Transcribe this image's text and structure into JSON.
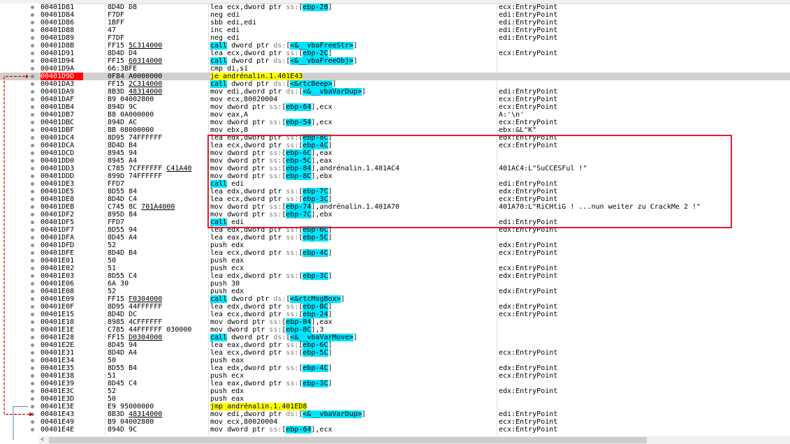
{
  "rows": [
    {
      "addr": "00401D81",
      "bytes": "8D4D D8",
      "instr": [
        {
          "t": "lea ecx,dword ptr "
        },
        {
          "t": "ss:",
          "c": "seg"
        },
        {
          "t": "["
        },
        {
          "t": "ebp-28",
          "c": "ref"
        },
        {
          "t": "]"
        }
      ],
      "cmt": "ecx:EntryPoint"
    },
    {
      "addr": "00401D84",
      "bytes": "F7DF",
      "instr": [
        {
          "t": "neg edi"
        }
      ],
      "cmt": "edi:EntryPoint"
    },
    {
      "addr": "00401D86",
      "bytes": "1BFF",
      "instr": [
        {
          "t": "sbb edi,edi"
        }
      ],
      "cmt": "edi:EntryPoint"
    },
    {
      "addr": "00401D88",
      "bytes": "47",
      "instr": [
        {
          "t": "inc edi"
        }
      ],
      "cmt": "edi:EntryPoint"
    },
    {
      "addr": "00401D89",
      "bytes": "F7DF",
      "instr": [
        {
          "t": "neg edi"
        }
      ],
      "cmt": "edi:EntryPoint"
    },
    {
      "addr": "00401D8B",
      "bytes": "FF15 ",
      "bytesU": "5C314000",
      "instr": [
        {
          "t": "call",
          "c": "call"
        },
        {
          "t": " dword ptr "
        },
        {
          "t": "ds:",
          "c": "seg"
        },
        {
          "t": "["
        },
        {
          "t": "<&__vbaFreeStr>",
          "c": "ref"
        },
        {
          "t": "]"
        }
      ],
      "cmt": ""
    },
    {
      "addr": "00401D91",
      "bytes": "8D4D D4",
      "instr": [
        {
          "t": "lea ecx,dword ptr "
        },
        {
          "t": "ss:",
          "c": "seg"
        },
        {
          "t": "["
        },
        {
          "t": "ebp-2C",
          "c": "ref"
        },
        {
          "t": "]"
        }
      ],
      "cmt": "ecx:EntryPoint"
    },
    {
      "addr": "00401D94",
      "bytes": "FF15 ",
      "bytesU": "60314000",
      "instr": [
        {
          "t": "call",
          "c": "call"
        },
        {
          "t": " dword ptr "
        },
        {
          "t": "ds:",
          "c": "seg"
        },
        {
          "t": "["
        },
        {
          "t": "<&__vbaFreeObj>",
          "c": "ref"
        },
        {
          "t": "]"
        }
      ],
      "cmt": ""
    },
    {
      "addr": "00401D9A",
      "bytes": "66:3BFE",
      "instr": [
        {
          "t": "cmp di,si"
        }
      ],
      "cmt": ""
    },
    {
      "addr": "00401D9D",
      "bytes": "0F84 A0000000",
      "sel": true,
      "instr": [
        {
          "t": "je andrénalin.1.401E43",
          "c": "hl"
        }
      ],
      "cmt": ""
    },
    {
      "addr": "00401DA3",
      "bytes": "FF15 ",
      "bytesU": "2C314000",
      "instr": [
        {
          "t": "call",
          "c": "call"
        },
        {
          "t": " dword ptr "
        },
        {
          "t": "ds:",
          "c": "seg"
        },
        {
          "t": "["
        },
        {
          "t": "<&rtcBeep>",
          "c": "ref"
        },
        {
          "t": "]"
        }
      ],
      "cmt": ""
    },
    {
      "addr": "00401DA9",
      "bytes": "8B3D ",
      "bytesU": "48314000",
      "instr": [
        {
          "t": "mov edi,dword ptr "
        },
        {
          "t": "ds:",
          "c": "seg"
        },
        {
          "t": "["
        },
        {
          "t": "<&__vbaVarDup>",
          "c": "ref"
        },
        {
          "t": "]"
        }
      ],
      "cmt": "edi:EntryPoint"
    },
    {
      "addr": "00401DAF",
      "bytes": "B9 04002800",
      "instr": [
        {
          "t": "mov ecx,80020004"
        }
      ],
      "cmt": "ecx:EntryPoint"
    },
    {
      "addr": "00401DB4",
      "bytes": "894D 9C",
      "instr": [
        {
          "t": "mov dword ptr "
        },
        {
          "t": "ss:",
          "c": "seg"
        },
        {
          "t": "["
        },
        {
          "t": "ebp-64",
          "c": "ref"
        },
        {
          "t": "],ecx"
        }
      ],
      "cmt": "ecx:EntryPoint"
    },
    {
      "addr": "00401DB7",
      "bytes": "B8 0A000000",
      "instr": [
        {
          "t": "mov eax,A"
        }
      ],
      "cmt": "A:'\\n'"
    },
    {
      "addr": "00401DBC",
      "bytes": "894D AC",
      "instr": [
        {
          "t": "mov dword ptr "
        },
        {
          "t": "ss:",
          "c": "seg"
        },
        {
          "t": "["
        },
        {
          "t": "ebp-54",
          "c": "ref"
        },
        {
          "t": "],ecx"
        }
      ],
      "cmt": "ecx:EntryPoint"
    },
    {
      "addr": "00401DBF",
      "bytes": "BB 08000000",
      "instr": [
        {
          "t": "mov ebx,8"
        }
      ],
      "cmt": "ebx:&L\"K\""
    },
    {
      "addr": "00401DC4",
      "bytes": "8D95 74FFFFFF",
      "instr": [
        {
          "t": "lea edx,dword ptr "
        },
        {
          "t": "ss:",
          "c": "seg"
        },
        {
          "t": "["
        },
        {
          "t": "ebp-8C",
          "c": "ref"
        },
        {
          "t": "]"
        }
      ],
      "cmt": "edx:EntryPoint"
    },
    {
      "addr": "00401DCA",
      "bytes": "8D4D B4",
      "instr": [
        {
          "t": "lea ecx,dword ptr "
        },
        {
          "t": "ss:",
          "c": "seg"
        },
        {
          "t": "["
        },
        {
          "t": "ebp-4C",
          "c": "ref"
        },
        {
          "t": "]"
        }
      ],
      "cmt": "ecx:EntryPoint"
    },
    {
      "addr": "00401DCD",
      "bytes": "8945 94",
      "instr": [
        {
          "t": "mov dword ptr "
        },
        {
          "t": "ss:",
          "c": "seg"
        },
        {
          "t": "["
        },
        {
          "t": "ebp-6C",
          "c": "ref"
        },
        {
          "t": "],eax"
        }
      ],
      "cmt": ""
    },
    {
      "addr": "00401DD0",
      "bytes": "8945 A4",
      "instr": [
        {
          "t": "mov dword ptr "
        },
        {
          "t": "ss:",
          "c": "seg"
        },
        {
          "t": "["
        },
        {
          "t": "ebp-5C",
          "c": "ref"
        },
        {
          "t": "],eax"
        }
      ],
      "cmt": ""
    },
    {
      "addr": "00401DD3",
      "bytes": "C785 7CFFFFFF ",
      "bytesU": "C41A40",
      "instr": [
        {
          "t": "mov dword ptr "
        },
        {
          "t": "ss:",
          "c": "seg"
        },
        {
          "t": "["
        },
        {
          "t": "ebp-84",
          "c": "ref"
        },
        {
          "t": "],andrénalin.1.401AC4"
        }
      ],
      "cmt": "401AC4:L\"SuCCESFul !\""
    },
    {
      "addr": "00401DDD",
      "bytes": "899D 74FFFFFF",
      "instr": [
        {
          "t": "mov dword ptr "
        },
        {
          "t": "ss:",
          "c": "seg"
        },
        {
          "t": "["
        },
        {
          "t": "ebp-8C",
          "c": "ref"
        },
        {
          "t": "],ebx"
        }
      ],
      "cmt": ""
    },
    {
      "addr": "00401DE3",
      "bytes": "FFD7",
      "instr": [
        {
          "t": "call",
          "c": "call"
        },
        {
          "t": " edi"
        }
      ],
      "cmt": "edi:EntryPoint"
    },
    {
      "addr": "00401DE5",
      "bytes": "8D55 84",
      "instr": [
        {
          "t": "lea edx,dword ptr "
        },
        {
          "t": "ss:",
          "c": "seg"
        },
        {
          "t": "["
        },
        {
          "t": "ebp-7C",
          "c": "ref"
        },
        {
          "t": "]"
        }
      ],
      "cmt": "edx:EntryPoint"
    },
    {
      "addr": "00401DE8",
      "bytes": "8D4D C4",
      "instr": [
        {
          "t": "lea ecx,dword ptr "
        },
        {
          "t": "ss:",
          "c": "seg"
        },
        {
          "t": "["
        },
        {
          "t": "ebp-3C",
          "c": "ref"
        },
        {
          "t": "]"
        }
      ],
      "cmt": "ecx:EntryPoint"
    },
    {
      "addr": "00401DEB",
      "bytes": "C745 8C ",
      "bytesU": "701A4000",
      "instr": [
        {
          "t": "mov dword ptr "
        },
        {
          "t": "ss:",
          "c": "seg"
        },
        {
          "t": "["
        },
        {
          "t": "ebp-74",
          "c": "ref"
        },
        {
          "t": "],andrénalin.1.401A70"
        }
      ],
      "cmt": "401A70:L\"RiCHtiG ! ...nun weiter zu CrackMe 2 !\""
    },
    {
      "addr": "00401DF2",
      "bytes": "895D 84",
      "instr": [
        {
          "t": "mov dword ptr "
        },
        {
          "t": "ss:",
          "c": "seg"
        },
        {
          "t": "["
        },
        {
          "t": "ebp-7C",
          "c": "ref"
        },
        {
          "t": "],ebx"
        }
      ],
      "cmt": ""
    },
    {
      "addr": "00401DF5",
      "bytes": "FFD7",
      "instr": [
        {
          "t": "call",
          "c": "call"
        },
        {
          "t": " edi"
        }
      ],
      "cmt": "edi:EntryPoint"
    },
    {
      "addr": "00401DF7",
      "bytes": "8D55 94",
      "instr": [
        {
          "t": "lea edx,dword ptr "
        },
        {
          "t": "ss:",
          "c": "seg"
        },
        {
          "t": "["
        },
        {
          "t": "ebp-6C",
          "c": "ref"
        },
        {
          "t": "]"
        }
      ],
      "cmt": "edx:EntryPoint"
    },
    {
      "addr": "00401DFA",
      "bytes": "8D45 A4",
      "instr": [
        {
          "t": "lea eax,dword ptr "
        },
        {
          "t": "ss:",
          "c": "seg"
        },
        {
          "t": "["
        },
        {
          "t": "ebp-5C",
          "c": "ref"
        },
        {
          "t": "]"
        }
      ],
      "cmt": ""
    },
    {
      "addr": "00401DFD",
      "bytes": "52",
      "instr": [
        {
          "t": "push edx"
        }
      ],
      "cmt": "edx:EntryPoint"
    },
    {
      "addr": "00401DFE",
      "bytes": "8D4D B4",
      "instr": [
        {
          "t": "lea ecx,dword ptr "
        },
        {
          "t": "ss:",
          "c": "seg"
        },
        {
          "t": "["
        },
        {
          "t": "ebp-4C",
          "c": "ref"
        },
        {
          "t": "]"
        }
      ],
      "cmt": "ecx:EntryPoint"
    },
    {
      "addr": "00401E01",
      "bytes": "50",
      "instr": [
        {
          "t": "push eax"
        }
      ],
      "cmt": ""
    },
    {
      "addr": "00401E02",
      "bytes": "51",
      "instr": [
        {
          "t": "push ecx"
        }
      ],
      "cmt": "ecx:EntryPoint"
    },
    {
      "addr": "00401E03",
      "bytes": "8D55 C4",
      "instr": [
        {
          "t": "lea edx,dword ptr "
        },
        {
          "t": "ss:",
          "c": "seg"
        },
        {
          "t": "["
        },
        {
          "t": "ebp-3C",
          "c": "ref"
        },
        {
          "t": "]"
        }
      ],
      "cmt": "edx:EntryPoint"
    },
    {
      "addr": "00401E06",
      "bytes": "6A 30",
      "instr": [
        {
          "t": "push 30"
        }
      ],
      "cmt": ""
    },
    {
      "addr": "00401E08",
      "bytes": "52",
      "instr": [
        {
          "t": "push edx"
        }
      ],
      "cmt": "edx:EntryPoint"
    },
    {
      "addr": "00401E09",
      "bytes": "FF15 ",
      "bytesU": "F0304000",
      "instr": [
        {
          "t": "call",
          "c": "call"
        },
        {
          "t": " dword ptr "
        },
        {
          "t": "ds:",
          "c": "seg"
        },
        {
          "t": "["
        },
        {
          "t": "<&rtcMsgBox>",
          "c": "ref"
        },
        {
          "t": "]"
        }
      ],
      "cmt": ""
    },
    {
      "addr": "00401E0F",
      "bytes": "8D95 44FFFFFF",
      "instr": [
        {
          "t": "lea edx,dword ptr "
        },
        {
          "t": "ss:",
          "c": "seg"
        },
        {
          "t": "["
        },
        {
          "t": "ebp-BC",
          "c": "ref"
        },
        {
          "t": "]"
        }
      ],
      "cmt": "edx:EntryPoint"
    },
    {
      "addr": "00401E15",
      "bytes": "8D4D DC",
      "instr": [
        {
          "t": "lea ecx,dword ptr "
        },
        {
          "t": "ss:",
          "c": "seg"
        },
        {
          "t": "["
        },
        {
          "t": "ebp-24",
          "c": "ref"
        },
        {
          "t": "]"
        }
      ],
      "cmt": "ecx:EntryPoint"
    },
    {
      "addr": "00401E18",
      "bytes": "8985 4CFFFFFF",
      "instr": [
        {
          "t": "mov dword ptr "
        },
        {
          "t": "ss:",
          "c": "seg"
        },
        {
          "t": "["
        },
        {
          "t": "ebp-B4",
          "c": "ref"
        },
        {
          "t": "],eax"
        }
      ],
      "cmt": ""
    },
    {
      "addr": "00401E1E",
      "bytes": "C785 44FFFFFF 030000",
      "instr": [
        {
          "t": "mov dword ptr "
        },
        {
          "t": "ss:",
          "c": "seg"
        },
        {
          "t": "["
        },
        {
          "t": "ebp-BC",
          "c": "ref"
        },
        {
          "t": "],3"
        }
      ],
      "cmt": ""
    },
    {
      "addr": "00401E28",
      "bytes": "FF15 ",
      "bytesU": "D0304000",
      "instr": [
        {
          "t": "call",
          "c": "call"
        },
        {
          "t": " dword ptr "
        },
        {
          "t": "ds:",
          "c": "seg"
        },
        {
          "t": "["
        },
        {
          "t": "<&__vbaVarMove>",
          "c": "ref"
        },
        {
          "t": "]"
        }
      ],
      "cmt": ""
    },
    {
      "addr": "00401E2E",
      "bytes": "8D45 94",
      "instr": [
        {
          "t": "lea eax,dword ptr "
        },
        {
          "t": "ss:",
          "c": "seg"
        },
        {
          "t": "["
        },
        {
          "t": "ebp-6C",
          "c": "ref"
        },
        {
          "t": "]"
        }
      ],
      "cmt": ""
    },
    {
      "addr": "00401E31",
      "bytes": "8D4D A4",
      "instr": [
        {
          "t": "lea ecx,dword ptr "
        },
        {
          "t": "ss:",
          "c": "seg"
        },
        {
          "t": "["
        },
        {
          "t": "ebp-5C",
          "c": "ref"
        },
        {
          "t": "]"
        }
      ],
      "cmt": "ecx:EntryPoint"
    },
    {
      "addr": "00401E34",
      "bytes": "50",
      "instr": [
        {
          "t": "push eax"
        }
      ],
      "cmt": ""
    },
    {
      "addr": "00401E35",
      "bytes": "8D55 B4",
      "instr": [
        {
          "t": "lea edx,dword ptr "
        },
        {
          "t": "ss:",
          "c": "seg"
        },
        {
          "t": "["
        },
        {
          "t": "ebp-4C",
          "c": "ref"
        },
        {
          "t": "]"
        }
      ],
      "cmt": "edx:EntryPoint"
    },
    {
      "addr": "00401E38",
      "bytes": "51",
      "instr": [
        {
          "t": "push ecx"
        }
      ],
      "cmt": "ecx:EntryPoint"
    },
    {
      "addr": "00401E39",
      "bytes": "8D45 C4",
      "instr": [
        {
          "t": "lea eax,dword ptr "
        },
        {
          "t": "ss:",
          "c": "seg"
        },
        {
          "t": "["
        },
        {
          "t": "ebp-3C",
          "c": "ref"
        },
        {
          "t": "]"
        }
      ],
      "cmt": ""
    },
    {
      "addr": "00401E3C",
      "bytes": "52",
      "instr": [
        {
          "t": "push edx"
        }
      ],
      "cmt": "edx:EntryPoint"
    },
    {
      "addr": "00401E3D",
      "bytes": "50",
      "instr": [
        {
          "t": "push eax"
        }
      ],
      "cmt": ""
    },
    {
      "addr": "00401E3E",
      "bytes": "E9 95000000",
      "instr": [
        {
          "t": "jmp andrénalin.1.401ED8",
          "c": "hl"
        }
      ],
      "cmt": ""
    },
    {
      "addr": "00401E43",
      "bytes": "8B3D ",
      "bytesU": "48314000",
      "instr": [
        {
          "t": "mov edi,dword ptr "
        },
        {
          "t": "ds:",
          "c": "seg"
        },
        {
          "t": "["
        },
        {
          "t": "<&__vbaVarDup>",
          "c": "ref"
        },
        {
          "t": "]"
        }
      ],
      "cmt": "edi:EntryPoint"
    },
    {
      "addr": "00401E49",
      "bytes": "B9 04002800",
      "instr": [
        {
          "t": "mov ecx,80020004"
        }
      ],
      "cmt": "ecx:EntryPoint"
    },
    {
      "addr": "00401E4E",
      "bytes": "894D 9C",
      "instr": [
        {
          "t": "mov dword ptr "
        },
        {
          "t": "ss:",
          "c": "seg"
        },
        {
          "t": "["
        },
        {
          "t": "ebp-64",
          "c": "ref"
        },
        {
          "t": "],ecx"
        }
      ],
      "cmt": "ecx:EntryPoint"
    }
  ],
  "scroll_left_glyph": "<",
  "colors": {
    "selected_addr_bg": "#ff0000",
    "call_bg": "#00e5ff",
    "highlight_bg": "#ffff00",
    "ref_text": "#8000ff",
    "jump_arrow": "#cc0000",
    "box_border": "#dd1f2e"
  }
}
